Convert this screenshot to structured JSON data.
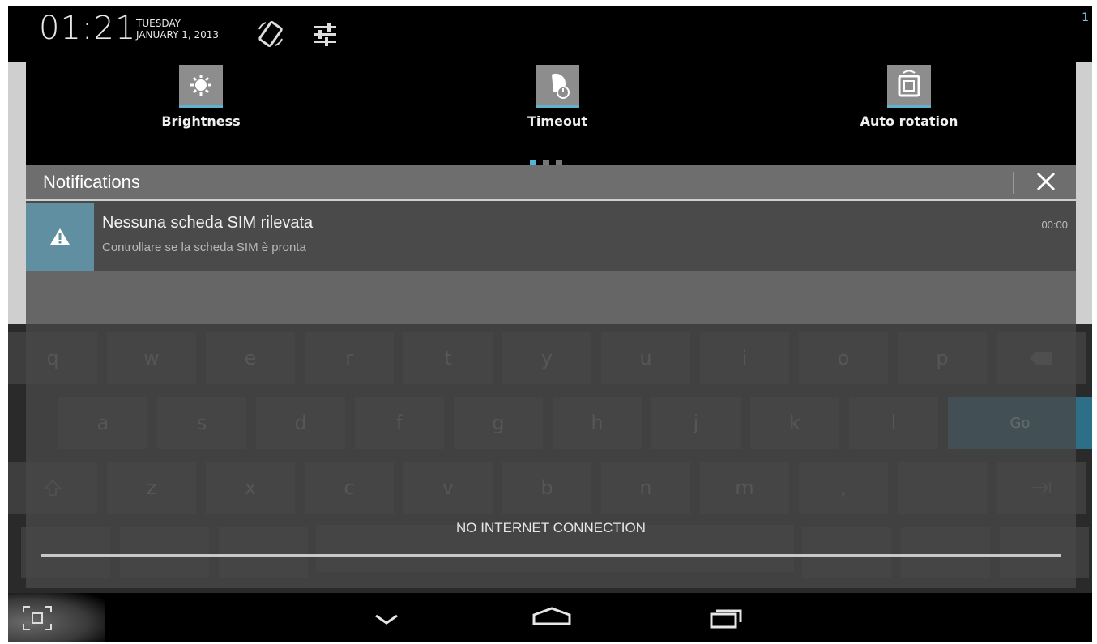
{
  "status_bar": {
    "time": "01:21",
    "day": "TUESDAY",
    "date": "JANUARY 1, 2013",
    "corner_number": "1",
    "icons": [
      "rotate-lock-icon",
      "settings-sliders-icon"
    ]
  },
  "quick_settings": {
    "tiles": [
      {
        "label": "Brightness",
        "icon": "brightness-icon"
      },
      {
        "label": "Timeout",
        "icon": "timeout-icon"
      },
      {
        "label": "Auto rotation",
        "icon": "auto-rotation-icon"
      }
    ],
    "pages": 3,
    "active_page": 1
  },
  "notifications": {
    "title": "Notifications",
    "clear_icon": "close-icon",
    "items": [
      {
        "icon": "warning-icon",
        "title": "Nessuna scheda SIM rilevata",
        "subtitle": "Controllare se la scheda SIM è pronta",
        "time": "00:00"
      }
    ],
    "footer_message": "NO INTERNET CONNECTION"
  },
  "keyboard": {
    "row1": [
      "q",
      "w",
      "e",
      "r",
      "t",
      "y",
      "u",
      "i",
      "o",
      "p"
    ],
    "row2": [
      "a",
      "s",
      "d",
      "f",
      "g",
      "h",
      "j",
      "k",
      "l"
    ],
    "row3": [
      "z",
      "x",
      "c",
      "v",
      "b",
      "n",
      "m",
      ","
    ],
    "go_label": "Go",
    "accent": "#2d6f86"
  },
  "nav_bar": {
    "buttons": [
      "back-icon",
      "home-icon",
      "recent-apps-icon"
    ],
    "left_button": "screenshot-icon"
  },
  "colors": {
    "accent": "#4fb6d8",
    "panel_header": "#6e6e6e",
    "notification_icon_bg": "#5f8fa0"
  }
}
